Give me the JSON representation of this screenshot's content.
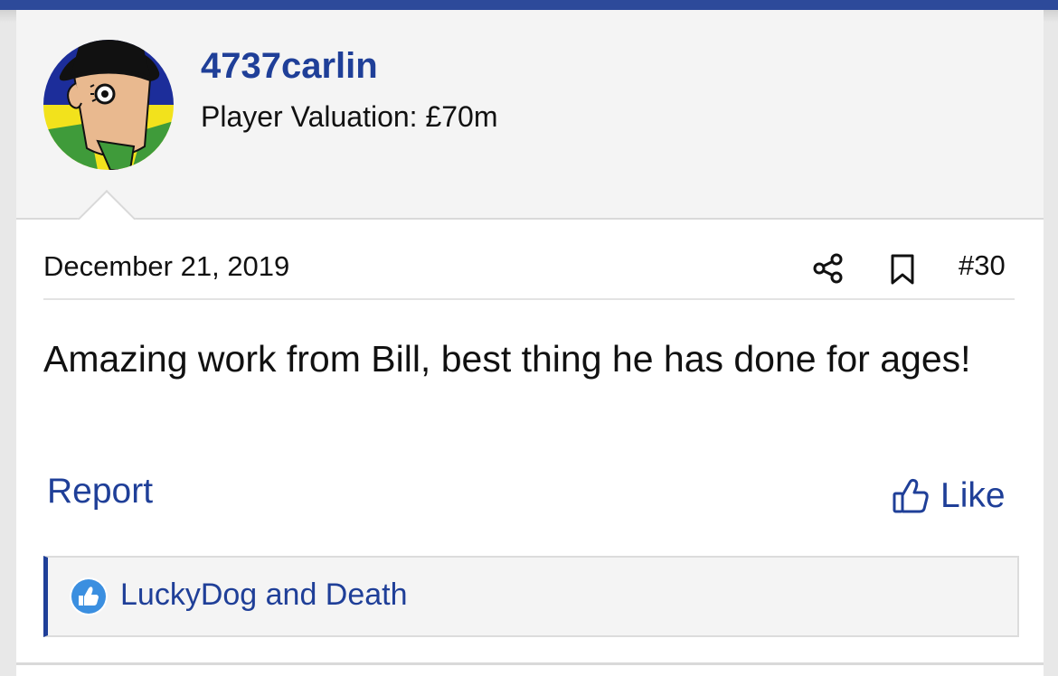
{
  "post": {
    "username": "4737carlin",
    "valuation": "Player Valuation: £70m",
    "date": "December 21, 2019",
    "number": "#30",
    "body": "Amazing work from Bill, best thing he has done for ages!",
    "report_label": "Report",
    "like_label": "Like",
    "reactions_text": "LuckyDog and Death"
  },
  "icons": {
    "share": "share-icon",
    "bookmark": "bookmark-icon",
    "like": "thumbs-up-icon",
    "reaction": "like-reaction-badge-icon"
  },
  "colors": {
    "accent": "#1f3f98",
    "top_bar": "#2d4a9a",
    "header_bg": "#f4f4f4",
    "text": "#111111",
    "reaction_badge": "#3b8fe0"
  }
}
